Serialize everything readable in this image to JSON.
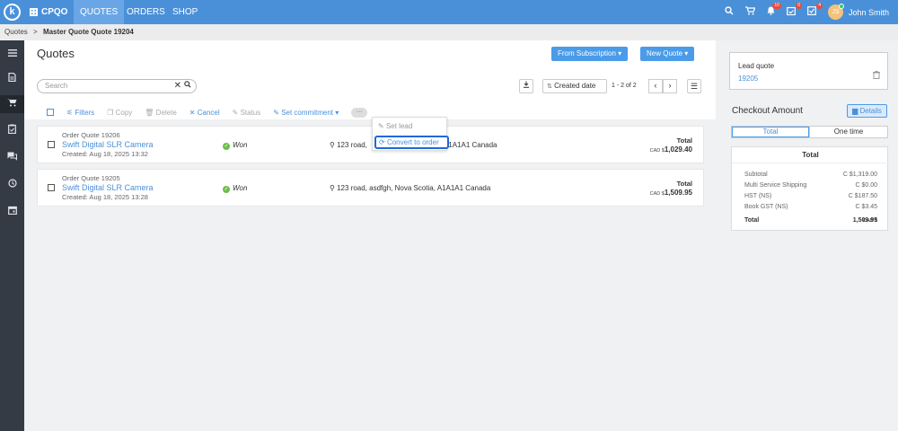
{
  "topbar": {
    "logo": "k",
    "brand": "CPQO",
    "nav": [
      {
        "label": "QUOTES",
        "active": true
      },
      {
        "label": "ORDERS",
        "active": false
      },
      {
        "label": "SHOP",
        "active": false
      }
    ],
    "icons": [
      "search-icon",
      "cart-icon",
      "bell-icon",
      "calendar-check-icon",
      "task-check-icon"
    ],
    "badges": {
      "bell": "10",
      "calendar": "0",
      "tasks": "4"
    },
    "user": {
      "initials": "JS",
      "name": "John Smith"
    }
  },
  "breadcrumb": {
    "root": "Quotes",
    "separator": ">",
    "current": "Master Quote Quote 19204"
  },
  "sidebar": {
    "items": [
      "menu-icon",
      "document-icon",
      "cart-icon",
      "clipboard-icon",
      "chat-icon",
      "history-icon",
      "calendar-icon"
    ]
  },
  "header": {
    "title": "Quotes",
    "from_subscription": "From Subscription",
    "new_quote": "New Quote"
  },
  "toolbar": {
    "search_placeholder": "Search",
    "sort_label": "Created date",
    "pagination": "1 - 2 of 2",
    "actions": {
      "filters": "Filters",
      "copy": "Copy",
      "delete": "Delete",
      "cancel": "Cancel",
      "status": "Status",
      "set_commitment": "Set commitment",
      "more": "···"
    }
  },
  "dropdown": {
    "set_lead": "Set lead",
    "convert_to_order": "Convert to order"
  },
  "quotes": [
    {
      "subtitle": "Order Quote 19206",
      "name": "Swift Digital SLR Camera",
      "created": "Created:  Aug 18, 2025 13:32",
      "status": "Won",
      "address": "123 road, asdfgh, Nova Scotia, A1A1A1 Canada",
      "address_visible_a": "123 road,",
      "address_visible_b": "A1A1A1 Canada",
      "total_label": "Total",
      "currency": "CAD $",
      "total": "1,029.40"
    },
    {
      "subtitle": "Order Quote 19205",
      "name": "Swift Digital SLR Camera",
      "created": "Created:  Aug 18, 2025 13:28",
      "status": "Won",
      "address": "123 road, asdfgh, Nova Scotia, A1A1A1 Canada",
      "total_label": "Total",
      "currency": "CAD $",
      "total": "1,509.95"
    }
  ],
  "right_panel": {
    "lead_label": "Lead quote",
    "lead_value": "19205",
    "checkout_title": "Checkout Amount",
    "details": "Details",
    "tabs": [
      "Total",
      "One time"
    ],
    "totals_title": "Total",
    "lines": [
      {
        "label": "Subtotal",
        "value": "C $1,319.00"
      },
      {
        "label": "Multi Service Shipping",
        "value": "C $0.00"
      },
      {
        "label": "HST (NS)",
        "value": "C $187.50"
      },
      {
        "label": "Book GST (NS)",
        "value": "C $3.45"
      }
    ],
    "total_label": "Total",
    "total_currency": "CAD $",
    "total_value": "1,509.95"
  },
  "colors": {
    "accent": "#4a90d9",
    "sidebar": "#353b45",
    "won": "#6bbf4a",
    "focus": "#2168d8"
  }
}
